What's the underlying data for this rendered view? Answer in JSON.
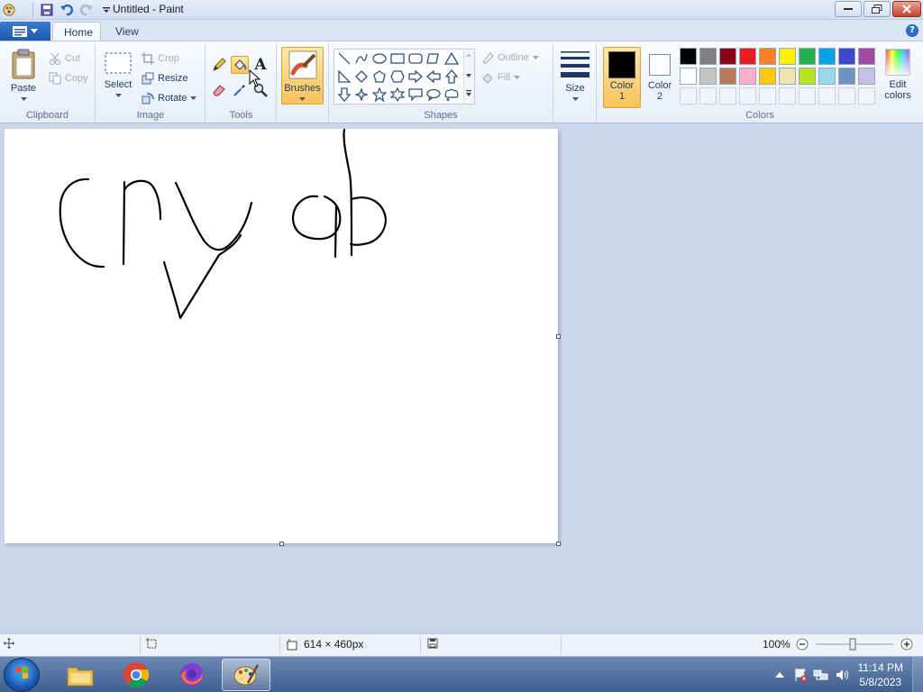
{
  "window": {
    "title": "Untitled - Paint"
  },
  "tabs": {
    "home": "Home",
    "view": "View"
  },
  "ribbon": {
    "clipboard": {
      "label": "Clipboard",
      "paste": "Paste",
      "cut": "Cut",
      "copy": "Copy"
    },
    "image": {
      "label": "Image",
      "select": "Select",
      "crop": "Crop",
      "resize": "Resize",
      "rotate": "Rotate"
    },
    "tools": {
      "label": "Tools",
      "active_tool": "fill-icon"
    },
    "brushes": {
      "label": "Brushes"
    },
    "shapes": {
      "label": "Shapes",
      "outline": "Outline",
      "fill": "Fill"
    },
    "size": {
      "label": "Size"
    },
    "colors": {
      "label": "Colors",
      "color1_label": "Color",
      "color1_num": "1",
      "color2_label": "Color",
      "color2_num": "2",
      "edit_label": "Edit",
      "edit_label2": "colors",
      "color1": "#000000",
      "color2": "#ffffff",
      "palette_row1": [
        "#000000",
        "#7f7f7f",
        "#880015",
        "#ed1c24",
        "#ff7f27",
        "#fff200",
        "#22b14c",
        "#00a2e8",
        "#3f48cc",
        "#a349a4"
      ],
      "palette_row2": [
        "#ffffff",
        "#c3c3c3",
        "#b97a57",
        "#ffaec9",
        "#ffc90e",
        "#efe4b0",
        "#b5e61d",
        "#99d9ea",
        "#7092be",
        "#c8bfe7"
      ]
    }
  },
  "canvas": {
    "drawn_text": "cry ф"
  },
  "status": {
    "dimensions": "614 × 460px",
    "zoom": "100%"
  },
  "clock": {
    "time": "11:14 PM",
    "date": "5/8/2023"
  }
}
